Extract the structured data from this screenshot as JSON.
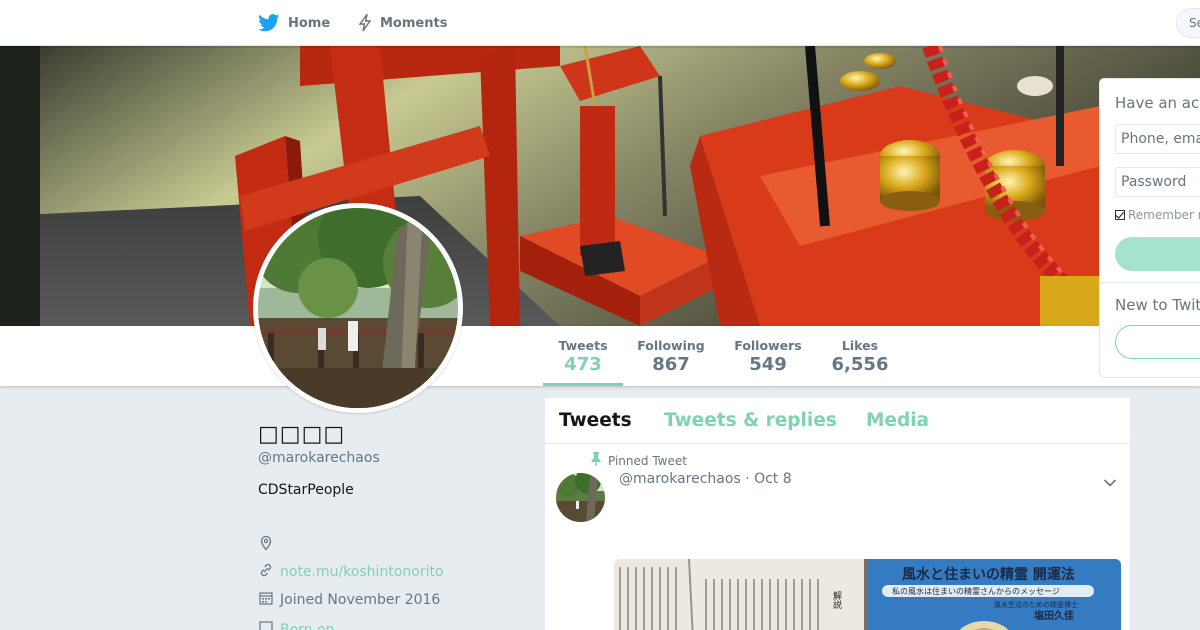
{
  "nav": {
    "home_label": "Home",
    "moments_label": "Moments",
    "search_placeholder": "Se",
    "brand_color": "#1da1f2"
  },
  "profile": {
    "name": "□□□□",
    "handle": "@marokarechaos",
    "bio": "CDStarPeople",
    "location": "",
    "url": "note.mu/koshintonorito",
    "joined": "Joined November 2016",
    "born": "Born on ..."
  },
  "stats": [
    {
      "label": "Tweets",
      "value": "473",
      "active": true
    },
    {
      "label": "Following",
      "value": "867",
      "active": false
    },
    {
      "label": "Followers",
      "value": "549",
      "active": false
    },
    {
      "label": "Likes",
      "value": "6,556",
      "active": false
    }
  ],
  "timeline": {
    "tabs": [
      "Tweets",
      "Tweets & replies",
      "Media"
    ],
    "active_tab": "Tweets",
    "pinned_label": "Pinned Tweet",
    "tweet_header": "@marokarechaos · Oct 8",
    "media_text": {
      "title": "風水と住まいの精霊 開運法",
      "subtitle": "私の風水は住まいの精霊さんからのメッセージ",
      "author_role": "風水生活のための精霊博士",
      "author": "塩田久佳",
      "page_heading": "解説"
    }
  },
  "login": {
    "title": "Have an acc",
    "phone_placeholder": "Phone, ema",
    "password_placeholder": "Password",
    "remember_label": "Remember m",
    "remember_checked": true,
    "new_label": "New to Twitt"
  },
  "colors": {
    "accent": "#7fd2b4",
    "accent_light": "#a4e4cc",
    "text_muted": "#657786",
    "background": "#e6ecf0"
  }
}
